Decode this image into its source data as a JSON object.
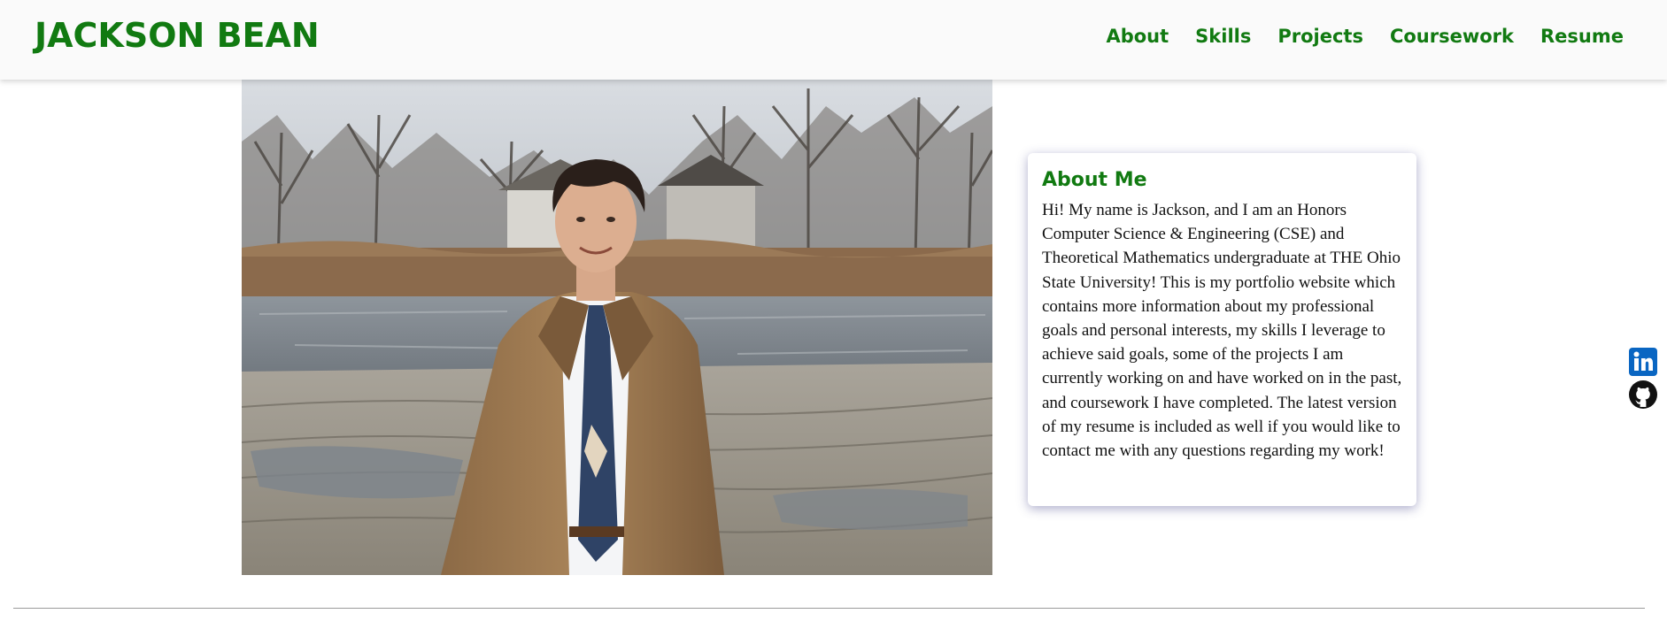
{
  "header": {
    "brand": "JACKSON BEAN",
    "nav": [
      "About",
      "Skills",
      "Projects",
      "Coursework",
      "Resume"
    ]
  },
  "about": {
    "title": "About Me",
    "text": "Hi! My name is Jackson, and I am an Honors Computer Science & Engineering (CSE) and Theoretical Mathematics undergraduate at THE Ohio State University! This is my portfolio website which contains more information about my professional goals and personal interests, my skills I leverage to achieve said goals, some of the projects I am currently working on and have worked on in the past, and coursework I have completed. The latest version of my resume is included as well if you would like to contact me with any questions regarding my work!"
  },
  "social": [
    {
      "icon": "linkedin-icon",
      "color": "#0a66c2"
    },
    {
      "icon": "github-icon",
      "color": "#111111"
    }
  ],
  "colors": {
    "accent": "#117a11",
    "header_bg": "#fafafa"
  }
}
